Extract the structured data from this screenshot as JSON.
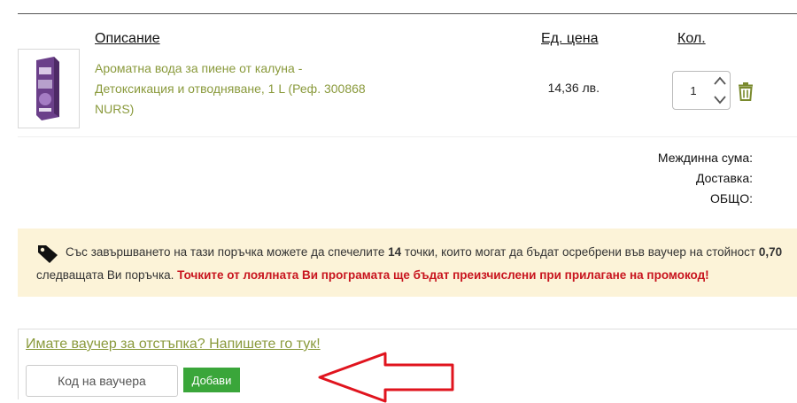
{
  "table": {
    "col_description": "Описание",
    "col_unit_price": "Ед. цена",
    "col_qty": "Кол."
  },
  "item": {
    "name_line1": "Ароматна вода за пиене от калуна -",
    "name_line2": "Детоксикация и отводняване, 1 L (Реф. 300868",
    "name_line3": "NURS)",
    "price": "14,36 лв.",
    "qty": "1",
    "image_icon": "product-bottle-box-image",
    "delete_icon": "trash-icon"
  },
  "totals": {
    "subtotal_label": "Междинна сума:",
    "shipping_label": "Доставка:",
    "total_label": "ОБЩО:"
  },
  "loyalty": {
    "icon": "tag-icon",
    "line1_prefix": "Със завършването на тази поръчка можете да спечелите ",
    "points": "14",
    "line1_suffix": " точки, които могат да бъдат осребрени във ваучер на стойност ",
    "line1_value": "0,70",
    "line2_prefix": "следващата Ви поръчка. ",
    "line2_warning": "Точките от лоялната Ви програмата ще бъдат преизчислени при прилагане на промокод!"
  },
  "voucher": {
    "link_text": "Имате ваучер за отстъпка? Напишете го тук!",
    "placeholder": "Код на ваучера",
    "add_button": "Добави"
  },
  "colors": {
    "link_green": "#8a9a3c",
    "button_green": "#3aa63a",
    "notice_bg": "#fcf3d8",
    "warning_red": "#c8141e",
    "arrow_red": "#e0141e"
  }
}
